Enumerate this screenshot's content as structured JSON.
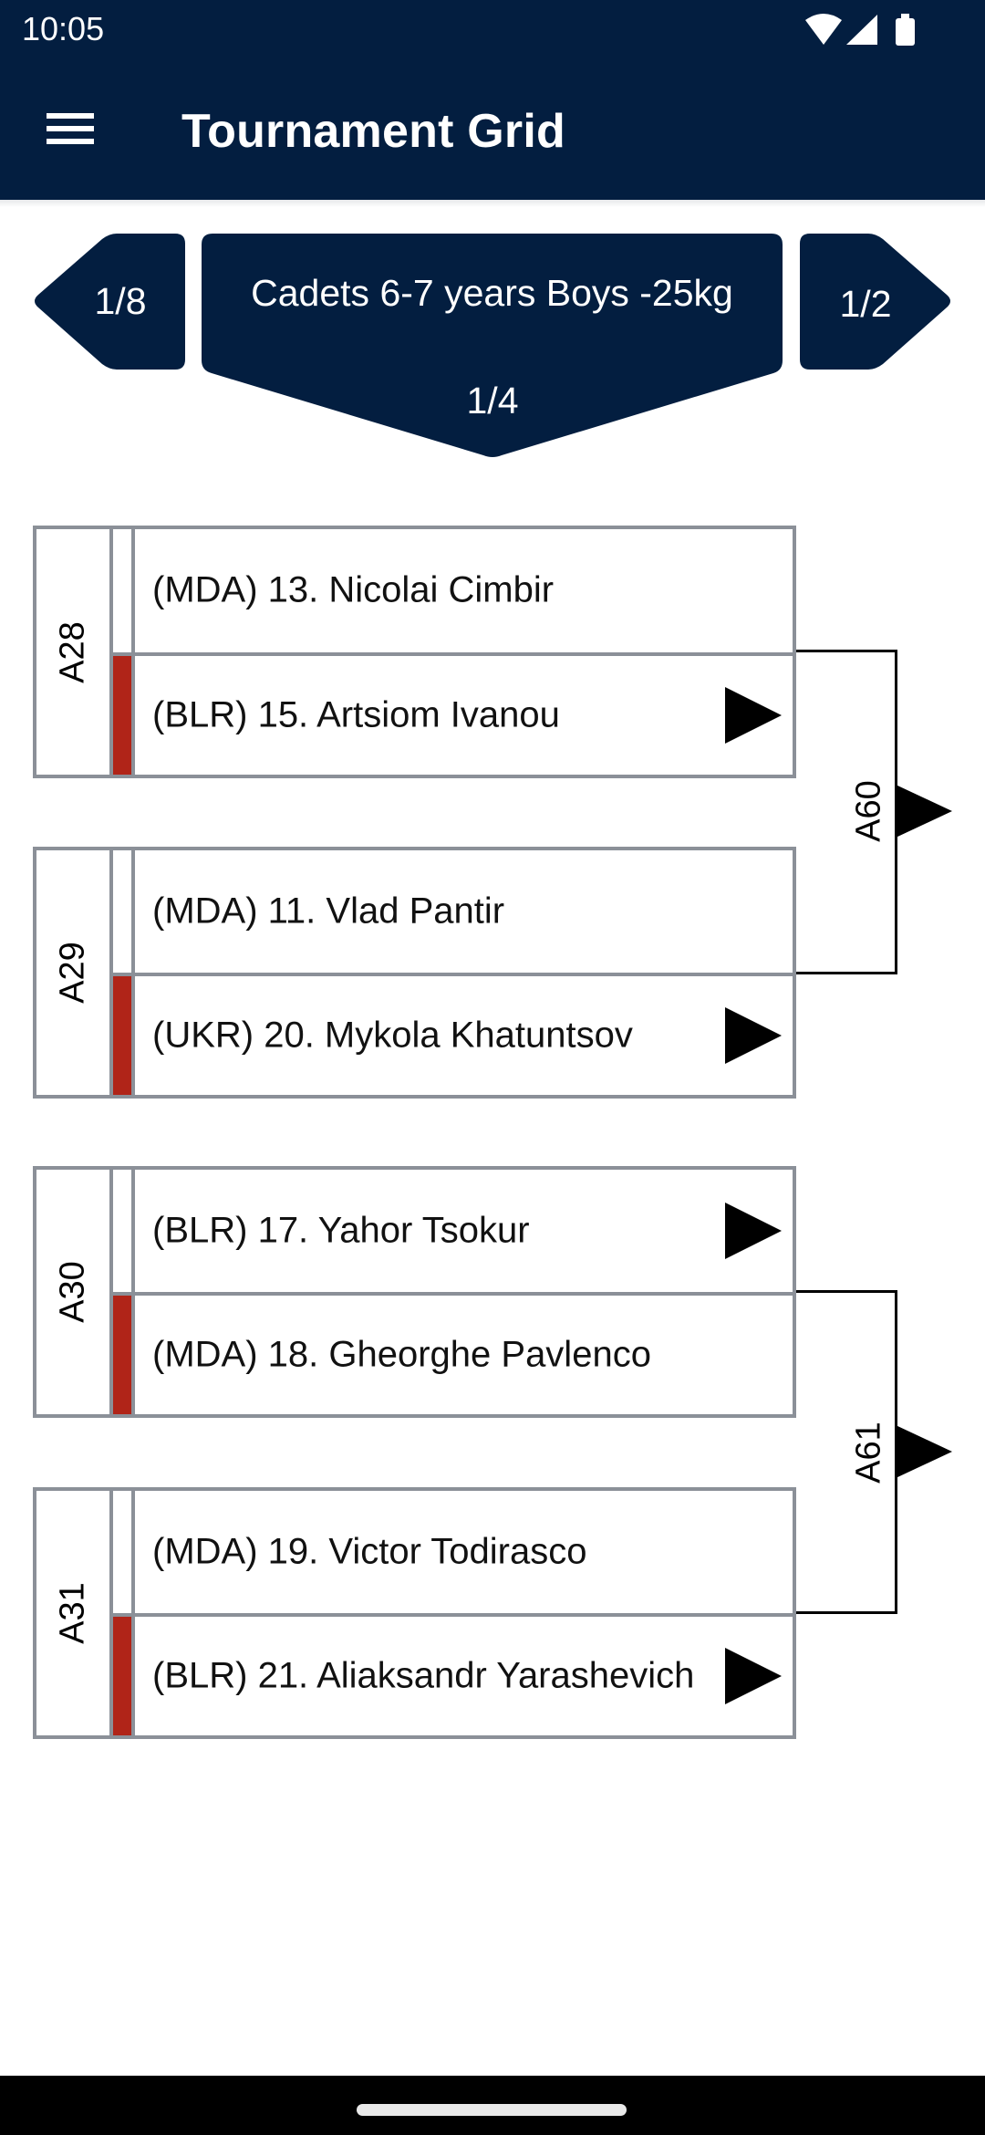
{
  "status_bar": {
    "time": "10:05",
    "icons": [
      "wifi-icon",
      "cell-signal-icon",
      "battery-icon"
    ]
  },
  "app_bar": {
    "menu_icon": "hamburger-menu-icon",
    "title": "Tournament Grid"
  },
  "colors": {
    "primary": "#031e40",
    "red_corner": "#b02418",
    "border": "#8b9098"
  },
  "round_nav": {
    "previous": "1/8",
    "category": "Cadets 6-7 years  Boys -25kg",
    "current": "1/4",
    "next": "1/2"
  },
  "matches": [
    {
      "id": "A28",
      "competitors": [
        {
          "text": "(MDA) 13. Nicolai Cimbir",
          "country": "MDA",
          "seed": 13,
          "name": "Nicolai Cimbir",
          "red": false,
          "advance_arrow": false
        },
        {
          "text": "(BLR) 15. Artsiom Ivanou",
          "country": "BLR",
          "seed": 15,
          "name": "Artsiom Ivanou",
          "red": true,
          "advance_arrow": true
        }
      ]
    },
    {
      "id": "A29",
      "competitors": [
        {
          "text": "(MDA) 11. Vlad Pantir",
          "country": "MDA",
          "seed": 11,
          "name": "Vlad Pantir",
          "red": false,
          "advance_arrow": false
        },
        {
          "text": "(UKR) 20. Mykola Khatuntsov",
          "country": "UKR",
          "seed": 20,
          "name": "Mykola Khatuntsov",
          "red": true,
          "advance_arrow": true
        }
      ]
    },
    {
      "id": "A30",
      "competitors": [
        {
          "text": "(BLR) 17. Yahor Tsokur",
          "country": "BLR",
          "seed": 17,
          "name": "Yahor Tsokur",
          "red": false,
          "advance_arrow": true
        },
        {
          "text": "(MDA) 18. Gheorghe Pavlenco",
          "country": "MDA",
          "seed": 18,
          "name": "Gheorghe Pavlenco",
          "red": true,
          "advance_arrow": false
        }
      ]
    },
    {
      "id": "A31",
      "competitors": [
        {
          "text": "(MDA) 19. Victor Todirasco",
          "country": "MDA",
          "seed": 19,
          "name": "Victor Todirasco",
          "red": false,
          "advance_arrow": false
        },
        {
          "text": "(BLR) 21. Aliaksandr Yarashevich",
          "country": "BLR",
          "seed": 21,
          "name": "Aliaksandr Yarashevich",
          "red": true,
          "advance_arrow": true
        }
      ]
    }
  ],
  "next_matches": [
    {
      "id": "A60",
      "from": [
        "A28",
        "A29"
      ]
    },
    {
      "id": "A61",
      "from": [
        "A30",
        "A31"
      ]
    }
  ]
}
